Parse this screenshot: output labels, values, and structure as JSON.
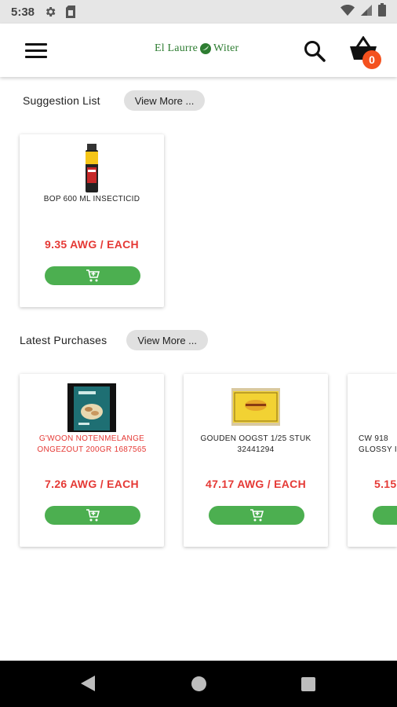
{
  "status_bar": {
    "time": "5:38",
    "icons": [
      "gear-icon",
      "sim-card-icon",
      "wifi-icon",
      "signal-icon",
      "battery-icon"
    ]
  },
  "app_bar": {
    "logo_left": "El Laurre",
    "logo_right": "Witer",
    "cart_count": "0",
    "icons": [
      "menu-icon",
      "search-icon",
      "shopping-basket-icon"
    ]
  },
  "suggestion": {
    "title": "Suggestion List",
    "view_more": "View More ...",
    "products": [
      {
        "name": "BOP 600 ML INSECTICID",
        "price": "9.35 AWG / EACH",
        "name_color": "#222222",
        "image": "spray-can-image"
      }
    ]
  },
  "latest": {
    "title": "Latest Purchases",
    "view_more": "View More ...",
    "products": [
      {
        "name": "G'WOON NOTENMELANGE ONGEZOUT 200GR 1687565",
        "price": "7.26 AWG / EACH",
        "name_color": "#e53935",
        "image": "nut-bag-image"
      },
      {
        "name": "GOUDEN OOGST 1/25 STUK 32441294",
        "price": "47.17 AWG / EACH",
        "name_color": "#222222",
        "image": "cigar-box-image"
      },
      {
        "name": "CW 918 GLOSSY I",
        "price": "5.15",
        "name_color": "#222222",
        "image": ""
      }
    ]
  },
  "colors": {
    "accent_green": "#4caf50",
    "price_red": "#e53935",
    "badge_orange": "#f4511e",
    "logo_green": "#2e7d32"
  }
}
